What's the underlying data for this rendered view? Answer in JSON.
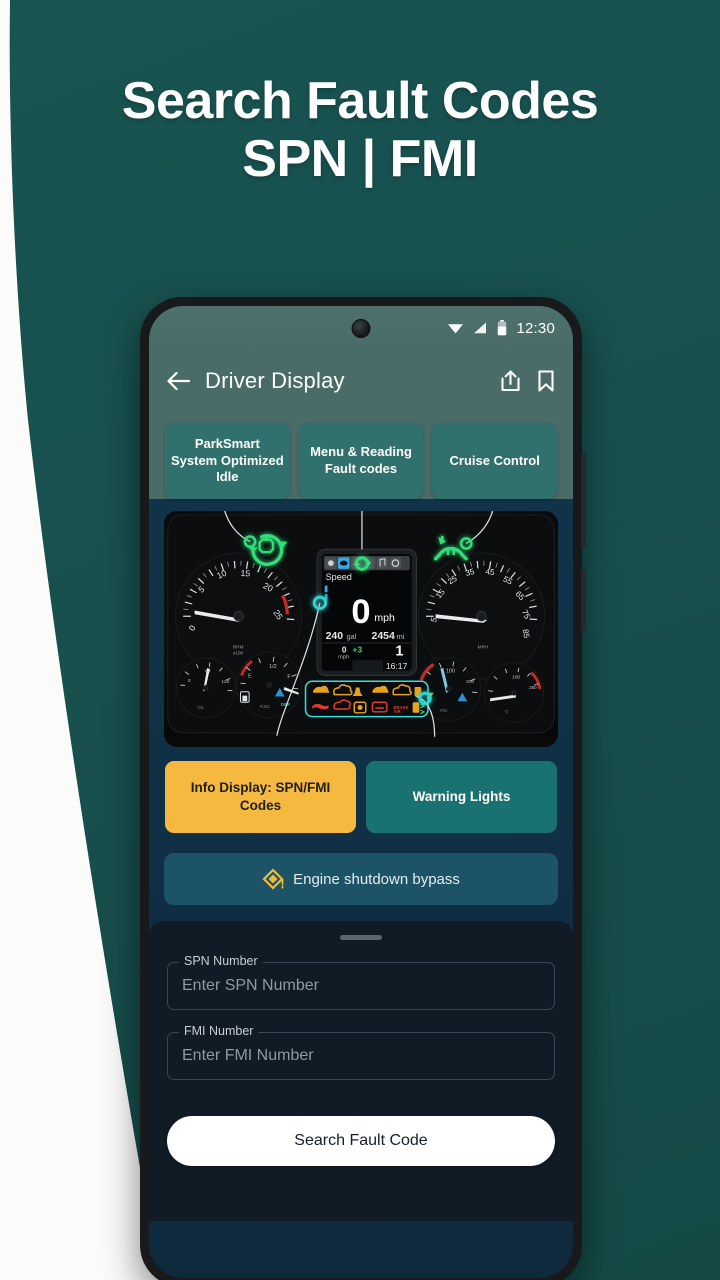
{
  "headline": {
    "line1": "Search Fault Codes",
    "line2": "SPN | FMI"
  },
  "colors": {
    "background_teal": "#1a5250",
    "appbar_teal": "#4a6c69",
    "chip_teal": "#30706d",
    "accent_amber": "#f6b93f",
    "accent_teal": "#19726f",
    "sheet_dark": "#111b26",
    "bypass_blue": "#1c5366",
    "glow_green": "#2ee07a",
    "glow_cyan": "#2fd6d0"
  },
  "phone": {
    "status_bar": {
      "time": "12:30",
      "icons": [
        "wifi-icon",
        "cellular-signal-icon",
        "battery-icon"
      ]
    },
    "app_bar": {
      "back_label": "back-arrow",
      "title": "Driver Display",
      "actions": [
        "share-icon",
        "bookmark-icon"
      ]
    },
    "chips": [
      {
        "label": "ParkSmart System Optimized Idle"
      },
      {
        "label": "Menu & Reading Fault codes"
      },
      {
        "label": "Cruise Control"
      }
    ],
    "dashboard": {
      "tachometer": {
        "ticks": [
          "0",
          "5",
          "10",
          "15",
          "20",
          "25"
        ],
        "unit": "RPM x100",
        "redline_from": "23"
      },
      "speedometer": {
        "ticks": [
          "5",
          "15",
          "25",
          "35",
          "45",
          "55",
          "65",
          "75",
          "85"
        ],
        "unit": "MPH"
      },
      "center_display": {
        "menu_label": "Speed",
        "speed_value": "0",
        "speed_unit": "mph",
        "fuel": "240 gal",
        "odometer": "2454 mi",
        "secondary_speed": "0",
        "secondary_speed_unit": "mph",
        "cruise_offset": "+3",
        "gear": "1",
        "time": "16:17"
      },
      "warning_lights": {
        "row_top_count": 6,
        "row_bottom_count": 6,
        "top_color": "#e8a31e",
        "bottom_color": "#e03c36"
      },
      "highlight_icons": [
        "engine-idle-icon",
        "cruise-control-icon"
      ]
    },
    "callouts": [
      {
        "label": "Info Display: SPN/FMI Codes",
        "style": "amber"
      },
      {
        "label": "Warning Lights",
        "style": "teal"
      }
    ],
    "bypass_bar": {
      "icon": "warning-diamond-icon",
      "label": "Engine shutdown bypass"
    },
    "form": {
      "spn": {
        "label": "SPN Number",
        "placeholder": "Enter SPN Number",
        "value": ""
      },
      "fmi": {
        "label": "FMI Number",
        "placeholder": "Enter FMI Number",
        "value": ""
      },
      "submit_label": "Search Fault Code"
    }
  }
}
